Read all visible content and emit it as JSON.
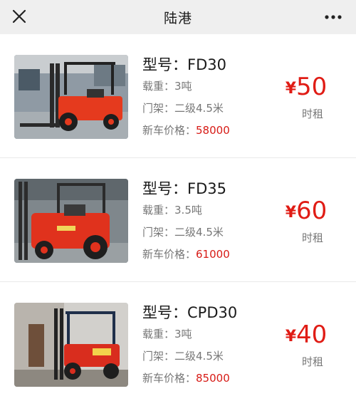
{
  "header": {
    "title": "陆港"
  },
  "icons": {
    "close": "close-icon",
    "more": "more-dots-icon"
  },
  "colors": {
    "price_red": "#e01c15",
    "header_bg": "#efefef",
    "forklift_red": "#e53a1e"
  },
  "products": [
    {
      "model_label": "型号：",
      "model": "FD30",
      "load_label": "载重：",
      "load": "3吨",
      "mast_label": "门架：",
      "mast": "二级4.5米",
      "price_label": "新车价格：",
      "price": "58000",
      "currency": "¥",
      "rent": "50",
      "rent_unit": "时租"
    },
    {
      "model_label": "型号：",
      "model": "FD35",
      "load_label": "载重：",
      "load": "3.5吨",
      "mast_label": "门架：",
      "mast": "二级4.5米",
      "price_label": "新车价格：",
      "price": "61000",
      "currency": "¥",
      "rent": "60",
      "rent_unit": "时租"
    },
    {
      "model_label": "型号：",
      "model": "CPD30",
      "load_label": "载重：",
      "load": "3吨",
      "mast_label": "门架：",
      "mast": "二级4.5米",
      "price_label": "新车价格：",
      "price": "85000",
      "currency": "¥",
      "rent": "40",
      "rent_unit": "时租"
    }
  ]
}
